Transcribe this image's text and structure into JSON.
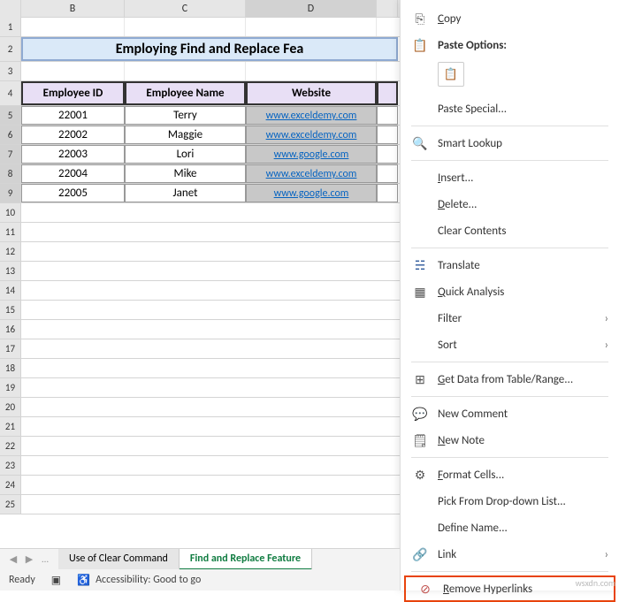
{
  "columns": {
    "b": "B",
    "c": "C",
    "d": "D"
  },
  "rows": {
    "r1": "1",
    "r2": "2",
    "r3": "3",
    "r4": "4",
    "r5": "5",
    "r6": "6",
    "r7": "7",
    "r8": "8",
    "r9": "9",
    "r10": "10",
    "r11": "11",
    "r12": "12",
    "r13": "13",
    "r14": "14",
    "r15": "15",
    "r16": "16",
    "r17": "17",
    "r18": "18",
    "r19": "19",
    "r20": "20",
    "r21": "21",
    "r22": "22",
    "r23": "23",
    "r24": "24",
    "r25": "25"
  },
  "title": "Employing Find and Replace Fea",
  "headers": {
    "id": "Employee ID",
    "name": "Employee Name",
    "site": "Website"
  },
  "data": [
    {
      "id": "22001",
      "name": "Terry",
      "site": "www.exceldemy.com"
    },
    {
      "id": "22002",
      "name": "Maggie",
      "site": "www.exceldemy.com"
    },
    {
      "id": "22003",
      "name": "Lori",
      "site": "www.google.com"
    },
    {
      "id": "22004",
      "name": "Mike",
      "site": "www.exceldemy.com"
    },
    {
      "id": "22005",
      "name": "Janet",
      "site": "www.google.com"
    }
  ],
  "ctx": {
    "copy": "Copy",
    "paste_options": "Paste Options:",
    "paste_special": "Paste Special...",
    "smart_lookup": "Smart Lookup",
    "insert": "Insert...",
    "delete": "Delete...",
    "clear_contents": "Clear Contents",
    "translate": "Translate",
    "quick_analysis": "Quick Analysis",
    "filter": "Filter",
    "sort": "Sort",
    "get_data": "Get Data from Table/Range...",
    "new_comment": "New Comment",
    "new_note": "New Note",
    "format_cells": "Format Cells...",
    "pick_list": "Pick From Drop-down List...",
    "define_name": "Define Name...",
    "link": "Link",
    "remove_hyperlinks": "Remove Hyperlinks"
  },
  "tabs": {
    "clear_cmd": "Use of Clear Command",
    "find_replace": "Find and Replace Feature"
  },
  "status": {
    "ready": "Ready",
    "accessibility": "Accessibility: Good to go"
  },
  "watermark": "wsxdn.com"
}
